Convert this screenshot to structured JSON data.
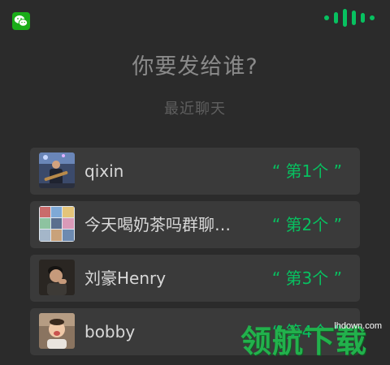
{
  "header": {
    "app_icon": "wechat-icon",
    "voice_indicator": "voice-listening-icon",
    "accent_color": "#07c160"
  },
  "title": "你要发给谁?",
  "subtitle": "最近聊天",
  "contacts": [
    {
      "name": "qixin",
      "ordinal": "“ 第1个 ”",
      "avatar": "guitarist-photo"
    },
    {
      "name": "今天喝奶茶吗群聊…",
      "ordinal": "“ 第2个 ”",
      "avatar": "group-chat-collage"
    },
    {
      "name": "刘豪Henry",
      "ordinal": "“ 第3个 ”",
      "avatar": "man-portrait-photo"
    },
    {
      "name": "bobby",
      "ordinal": "“ 第4个 ”",
      "avatar": "child-photo"
    }
  ],
  "watermark": {
    "domain": "lhdown.com",
    "brand": "领航下载"
  }
}
